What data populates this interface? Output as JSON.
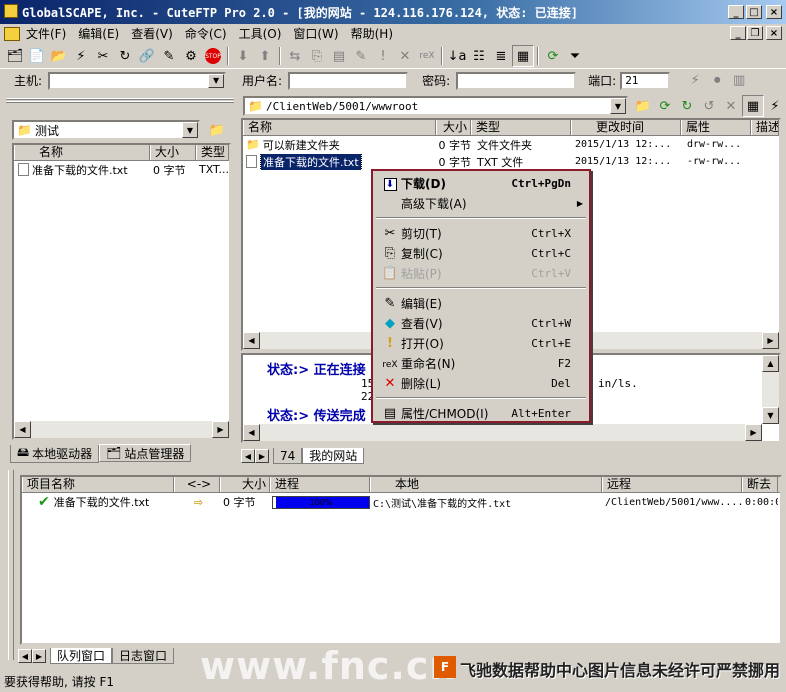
{
  "window": {
    "title": "GlobalSCAPE, Inc. - CuteFTP Pro 2.0 - [我的网站 - 124.116.176.124, 状态: 已连接]"
  },
  "menu": [
    "文件(F)",
    "编辑(E)",
    "查看(V)",
    "命令(C)",
    "工具(O)",
    "窗口(W)",
    "帮助(H)"
  ],
  "connect": {
    "host_label": "主机:",
    "host_value": "",
    "user_label": "用户名:",
    "user_value": "",
    "pass_label": "密码:",
    "pass_value": "",
    "port_label": "端口:",
    "port_value": "21"
  },
  "local": {
    "folder": "测试",
    "columns": [
      "名称",
      "大小",
      "类型"
    ],
    "files": [
      {
        "name": "准备下载的文件.txt",
        "size": "0 字节",
        "type": "TXT..."
      }
    ]
  },
  "remote": {
    "path": "/ClientWeb/5001/wwwroot",
    "columns": [
      "名称",
      "大小",
      "类型",
      "更改时间",
      "属性",
      "描述"
    ],
    "files": [
      {
        "name": "可以新建文件夹",
        "size": "0 字节",
        "type": "文件文件夹",
        "time": "2015/1/13 12:...",
        "attr": "drw-rw..."
      },
      {
        "name": "准备下载的文件.txt",
        "size": "0 字节",
        "type": "TXT 文件",
        "time": "2015/1/13 12:...",
        "attr": "-rw-rw..."
      }
    ]
  },
  "log": {
    "status1_label": "状态:>",
    "status1_text": "正在连接",
    "line2": "15",
    "line3": "22",
    "line_tail": "in/ls.",
    "status2_label": "状态:>",
    "status2_text": "传送完成"
  },
  "context_menu": [
    {
      "label": "下载(D)",
      "shortcut": "Ctrl+PgDn",
      "icon": "download-icon",
      "bold": true
    },
    {
      "label": "高级下载(A)",
      "shortcut": "",
      "icon": "",
      "submenu": true
    },
    {
      "sep": true
    },
    {
      "label": "剪切(T)",
      "shortcut": "Ctrl+X",
      "icon": "scissors-icon"
    },
    {
      "label": "复制(C)",
      "shortcut": "Ctrl+C",
      "icon": "copy-icon"
    },
    {
      "label": "粘贴(P)",
      "shortcut": "Ctrl+V",
      "icon": "paste-icon",
      "disabled": true
    },
    {
      "sep": true
    },
    {
      "label": "编辑(E)",
      "shortcut": "",
      "icon": "edit-icon"
    },
    {
      "label": "查看(V)",
      "shortcut": "Ctrl+W",
      "icon": "view-icon"
    },
    {
      "label": "打开(O)",
      "shortcut": "Ctrl+E",
      "icon": "exclamation-icon"
    },
    {
      "label": "重命名(N)",
      "shortcut": "F2",
      "icon": "rename-icon"
    },
    {
      "label": "删除(L)",
      "shortcut": "Del",
      "icon": "delete-icon"
    },
    {
      "sep": true
    },
    {
      "label": "属性/CHMOD(I)",
      "shortcut": "Alt+Enter",
      "icon": "properties-icon"
    }
  ],
  "tabs_left": [
    "本地驱动器",
    "站点管理器"
  ],
  "tabs_right": [
    "74",
    "我的网站"
  ],
  "queue": {
    "columns": [
      "项目名称",
      "<->",
      "大小",
      "进程",
      "本地",
      "远程",
      "断去"
    ],
    "rows": [
      {
        "name": "准备下载的文件.txt",
        "size": "0 字节",
        "progress_text": "100%",
        "progress": 1.0,
        "local": "C:\\测试\\准备下载的文件.txt",
        "remote": "/ClientWeb/5001/www....",
        "time": "0:00:0"
      }
    ]
  },
  "bottom_tabs": [
    "队列窗口",
    "日志窗口"
  ],
  "watermark": {
    "site": "www.fnc.cn",
    "notice": "飞驰数据帮助中心图片信息未经许可严禁挪用"
  },
  "status": {
    "text": "要获得帮助, 请按 F1"
  },
  "colors": {
    "title_start": "#0a246a",
    "progress": "#0000ee",
    "menu_border": "#8b1a2b",
    "log_blue": "#0000aa",
    "check": "#1a9a1a"
  }
}
